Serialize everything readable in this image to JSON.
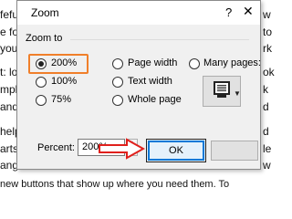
{
  "document": {
    "right_fragments": [
      "w",
      "to",
      "rk",
      "ok",
      "k",
      "d",
      "d",
      "le",
      "w",
      "To"
    ],
    "left_fragments": [
      "feful",
      "e for",
      "your",
      "t: loo",
      "mple",
      "and",
      "help",
      "arts,",
      "ange"
    ],
    "bottom_line": "new buttons that show up where you need them. To"
  },
  "dialog": {
    "title": "Zoom",
    "help_glyph": "?",
    "close_glyph": "✕",
    "group_label": "Zoom to",
    "options": {
      "zoom_200": "200%",
      "zoom_100": "100%",
      "zoom_75": "75%",
      "page_width": "Page width",
      "text_width": "Text width",
      "whole_page": "Whole page",
      "many_pages": "Many pages:"
    },
    "selected_option": "zoom_200",
    "percent_label": "Percent:",
    "percent_value": "200%",
    "ok_label": "OK",
    "cancel_label": ""
  },
  "colors": {
    "highlight": "#f07f2a",
    "arrow": "#e0201c",
    "ok_border": "#0078d7"
  },
  "icons": {
    "many_pages": "monitor-icon",
    "spin_up": "spin-up-icon",
    "spin_down": "spin-down-icon",
    "pointer": "red-arrow-icon"
  }
}
